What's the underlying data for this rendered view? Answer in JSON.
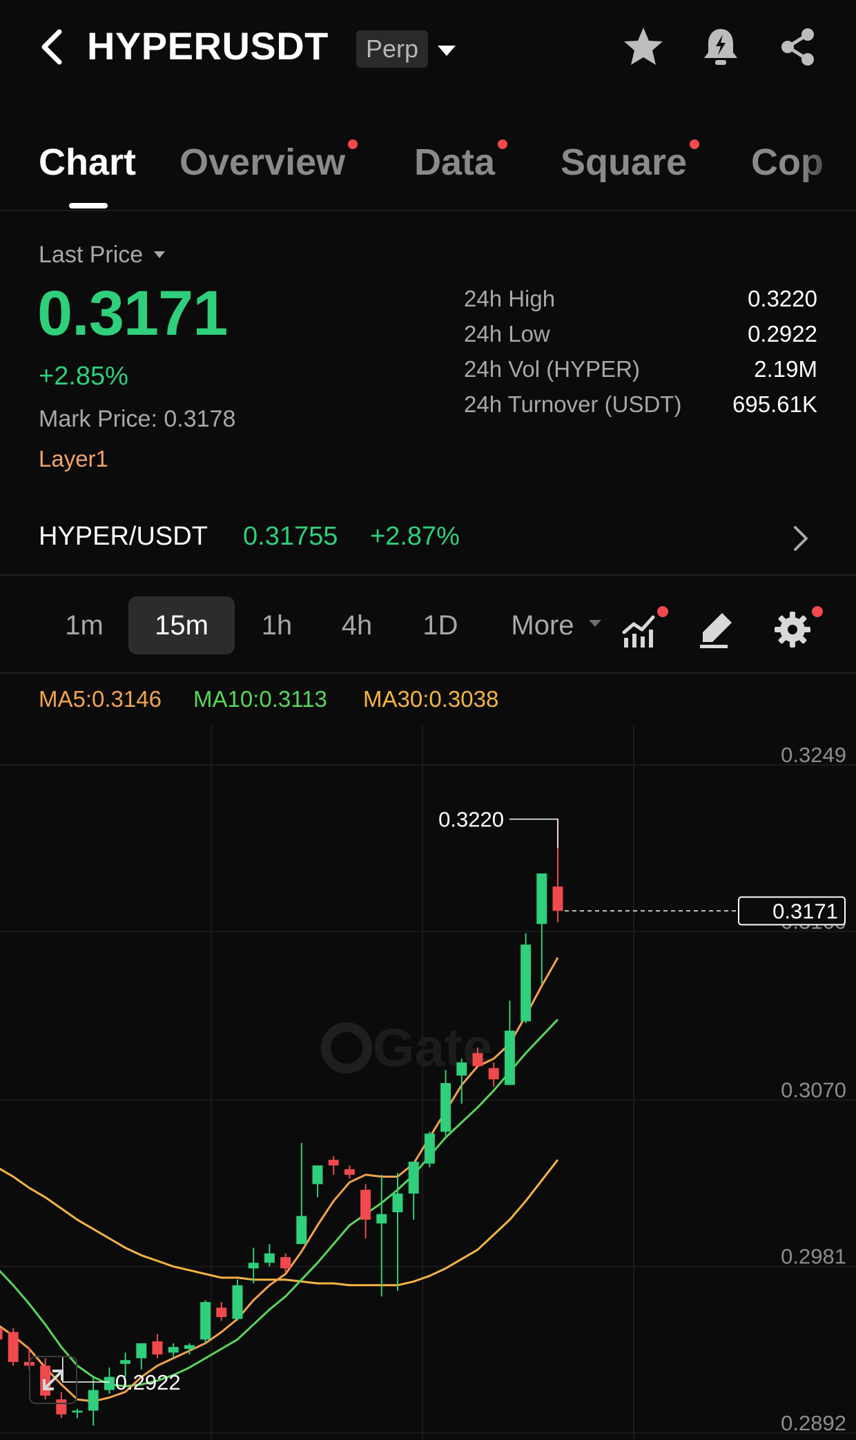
{
  "header": {
    "symbol": "HYPERUSDT",
    "contract_type": "Perp"
  },
  "tabs": [
    {
      "label": "Chart",
      "active": true,
      "badge": false
    },
    {
      "label": "Overview",
      "active": false,
      "badge": true
    },
    {
      "label": "Data",
      "active": false,
      "badge": true
    },
    {
      "label": "Square",
      "active": false,
      "badge": true
    },
    {
      "label": "Cop",
      "active": false,
      "badge": false
    }
  ],
  "price": {
    "label": "Last Price",
    "last": "0.3171",
    "change": "+2.85%",
    "mark_label": "Mark Price:",
    "mark_value": "0.3178",
    "tag": "Layer1"
  },
  "stats": [
    {
      "label": "24h High",
      "value": "0.3220"
    },
    {
      "label": "24h Low",
      "value": "0.2922"
    },
    {
      "label": "24h Vol (HYPER)",
      "value": "2.19M"
    },
    {
      "label": "24h Turnover (USDT)",
      "value": "695.61K"
    }
  ],
  "spot": {
    "pair": "HYPER/USDT",
    "price": "0.31755",
    "change": "+2.87%"
  },
  "intervals": {
    "items": [
      "1m",
      "15m",
      "1h",
      "4h",
      "1D"
    ],
    "active": "15m",
    "more": "More"
  },
  "ma_legend": {
    "ma5": "MA5:0.3146",
    "ma10": "MA10:0.3113",
    "ma30": "MA30:0.3038"
  },
  "colors": {
    "up": "#2fcf7b",
    "down": "#f0494e",
    "ma5": "#f2a24e",
    "ma10": "#58d65c",
    "ma30": "#f5b445"
  },
  "icons": [
    "back-arrow-icon",
    "caret-down-icon",
    "star-icon",
    "price-alert-bell-icon",
    "share-icon",
    "indicators-icon",
    "draw-pen-icon",
    "settings-gear-icon",
    "expand-icon"
  ],
  "chart_data": {
    "type": "candlestick",
    "interval": "15m",
    "y_ticks": [
      0.3249,
      0.316,
      0.307,
      0.2981,
      0.2892
    ],
    "ylim": [
      0.2892,
      0.3249
    ],
    "high_marker": {
      "label": "0.3220",
      "value": 0.322
    },
    "low_marker": {
      "label": "0.2922",
      "value": 0.2922
    },
    "last_price": {
      "label": "0.3171",
      "value": 0.3171
    },
    "candles": [
      {
        "o": 0.2948,
        "h": 0.2951,
        "l": 0.2935,
        "c": 0.2942
      },
      {
        "o": 0.2946,
        "h": 0.2948,
        "l": 0.2928,
        "c": 0.293
      },
      {
        "o": 0.293,
        "h": 0.2938,
        "l": 0.2926,
        "c": 0.2928
      },
      {
        "o": 0.2928,
        "h": 0.2932,
        "l": 0.291,
        "c": 0.2912
      },
      {
        "o": 0.291,
        "h": 0.2914,
        "l": 0.29,
        "c": 0.2902
      },
      {
        "o": 0.2903,
        "h": 0.2905,
        "l": 0.29,
        "c": 0.2904
      },
      {
        "o": 0.2904,
        "h": 0.2922,
        "l": 0.2896,
        "c": 0.2915
      },
      {
        "o": 0.2915,
        "h": 0.2927,
        "l": 0.2913,
        "c": 0.2922
      },
      {
        "o": 0.2929,
        "h": 0.2935,
        "l": 0.2922,
        "c": 0.2931
      },
      {
        "o": 0.2932,
        "h": 0.294,
        "l": 0.2926,
        "c": 0.294
      },
      {
        "o": 0.2941,
        "h": 0.2945,
        "l": 0.2932,
        "c": 0.2934
      },
      {
        "o": 0.2935,
        "h": 0.294,
        "l": 0.2932,
        "c": 0.2938
      },
      {
        "o": 0.2937,
        "h": 0.294,
        "l": 0.2934,
        "c": 0.2939
      },
      {
        "o": 0.2942,
        "h": 0.2963,
        "l": 0.294,
        "c": 0.2962
      },
      {
        "o": 0.2959,
        "h": 0.2962,
        "l": 0.2952,
        "c": 0.2954
      },
      {
        "o": 0.2953,
        "h": 0.2974,
        "l": 0.2952,
        "c": 0.2971
      },
      {
        "o": 0.298,
        "h": 0.2991,
        "l": 0.2972,
        "c": 0.2983
      },
      {
        "o": 0.2983,
        "h": 0.2993,
        "l": 0.2981,
        "c": 0.2988
      },
      {
        "o": 0.2986,
        "h": 0.2988,
        "l": 0.2978,
        "c": 0.298
      },
      {
        "o": 0.2993,
        "h": 0.3047,
        "l": 0.2993,
        "c": 0.3008
      },
      {
        "o": 0.3025,
        "h": 0.3035,
        "l": 0.3018,
        "c": 0.3035
      },
      {
        "o": 0.3038,
        "h": 0.304,
        "l": 0.303,
        "c": 0.3035
      },
      {
        "o": 0.3033,
        "h": 0.3035,
        "l": 0.3028,
        "c": 0.303
      },
      {
        "o": 0.3022,
        "h": 0.3025,
        "l": 0.2996,
        "c": 0.3006
      },
      {
        "o": 0.3004,
        "h": 0.303,
        "l": 0.2965,
        "c": 0.3009
      },
      {
        "o": 0.301,
        "h": 0.3031,
        "l": 0.2968,
        "c": 0.302
      },
      {
        "o": 0.302,
        "h": 0.3035,
        "l": 0.3006,
        "c": 0.3037
      },
      {
        "o": 0.3036,
        "h": 0.3053,
        "l": 0.3034,
        "c": 0.3052
      },
      {
        "o": 0.3053,
        "h": 0.3086,
        "l": 0.3051,
        "c": 0.3079
      },
      {
        "o": 0.3083,
        "h": 0.3092,
        "l": 0.3068,
        "c": 0.309
      },
      {
        "o": 0.3095,
        "h": 0.3098,
        "l": 0.3088,
        "c": 0.3088
      },
      {
        "o": 0.3087,
        "h": 0.309,
        "l": 0.3077,
        "c": 0.3081
      },
      {
        "o": 0.3078,
        "h": 0.3123,
        "l": 0.3078,
        "c": 0.3107
      },
      {
        "o": 0.3112,
        "h": 0.3159,
        "l": 0.3111,
        "c": 0.3153
      },
      {
        "o": 0.3164,
        "h": 0.3185,
        "l": 0.3132,
        "c": 0.3191
      },
      {
        "o": 0.3184,
        "h": 0.322,
        "l": 0.3165,
        "c": 0.3171
      }
    ],
    "ma30_endpoints_note": "",
    "ma": {
      "ma5": [
        0.295,
        0.2944,
        0.2937,
        0.2927,
        0.2918,
        0.291,
        0.2909,
        0.2911,
        0.2914,
        0.2922,
        0.2928,
        0.2932,
        0.2936,
        0.294,
        0.2946,
        0.2953,
        0.2963,
        0.2971,
        0.2977,
        0.2989,
        0.3003,
        0.3016,
        0.3026,
        0.303,
        0.3029,
        0.3029,
        0.3036,
        0.305,
        0.3064,
        0.3078,
        0.3088,
        0.3092,
        0.31,
        0.3115,
        0.3131,
        0.3146
      ],
      "ma10": [
        0.298,
        0.2971,
        0.2961,
        0.295,
        0.2938,
        0.2928,
        0.2922,
        0.2918,
        0.2917,
        0.2918,
        0.292,
        0.2923,
        0.2927,
        0.2932,
        0.2937,
        0.2942,
        0.295,
        0.2958,
        0.2965,
        0.2974,
        0.2983,
        0.2993,
        0.3003,
        0.3009,
        0.3015,
        0.3022,
        0.303,
        0.304,
        0.305,
        0.3058,
        0.3066,
        0.3075,
        0.3085,
        0.3095,
        0.3104,
        0.3113
      ],
      "ma30": [
        0.3034,
        0.3029,
        0.3023,
        0.3018,
        0.3012,
        0.3006,
        0.3001,
        0.2996,
        0.2991,
        0.2987,
        0.2984,
        0.2981,
        0.2979,
        0.2977,
        0.2975,
        0.2975,
        0.2974,
        0.2974,
        0.2974,
        0.2973,
        0.2972,
        0.2972,
        0.2971,
        0.2971,
        0.2971,
        0.2971,
        0.2973,
        0.2976,
        0.298,
        0.2985,
        0.299,
        0.2998,
        0.3006,
        0.3016,
        0.3027,
        0.3038
      ]
    }
  }
}
